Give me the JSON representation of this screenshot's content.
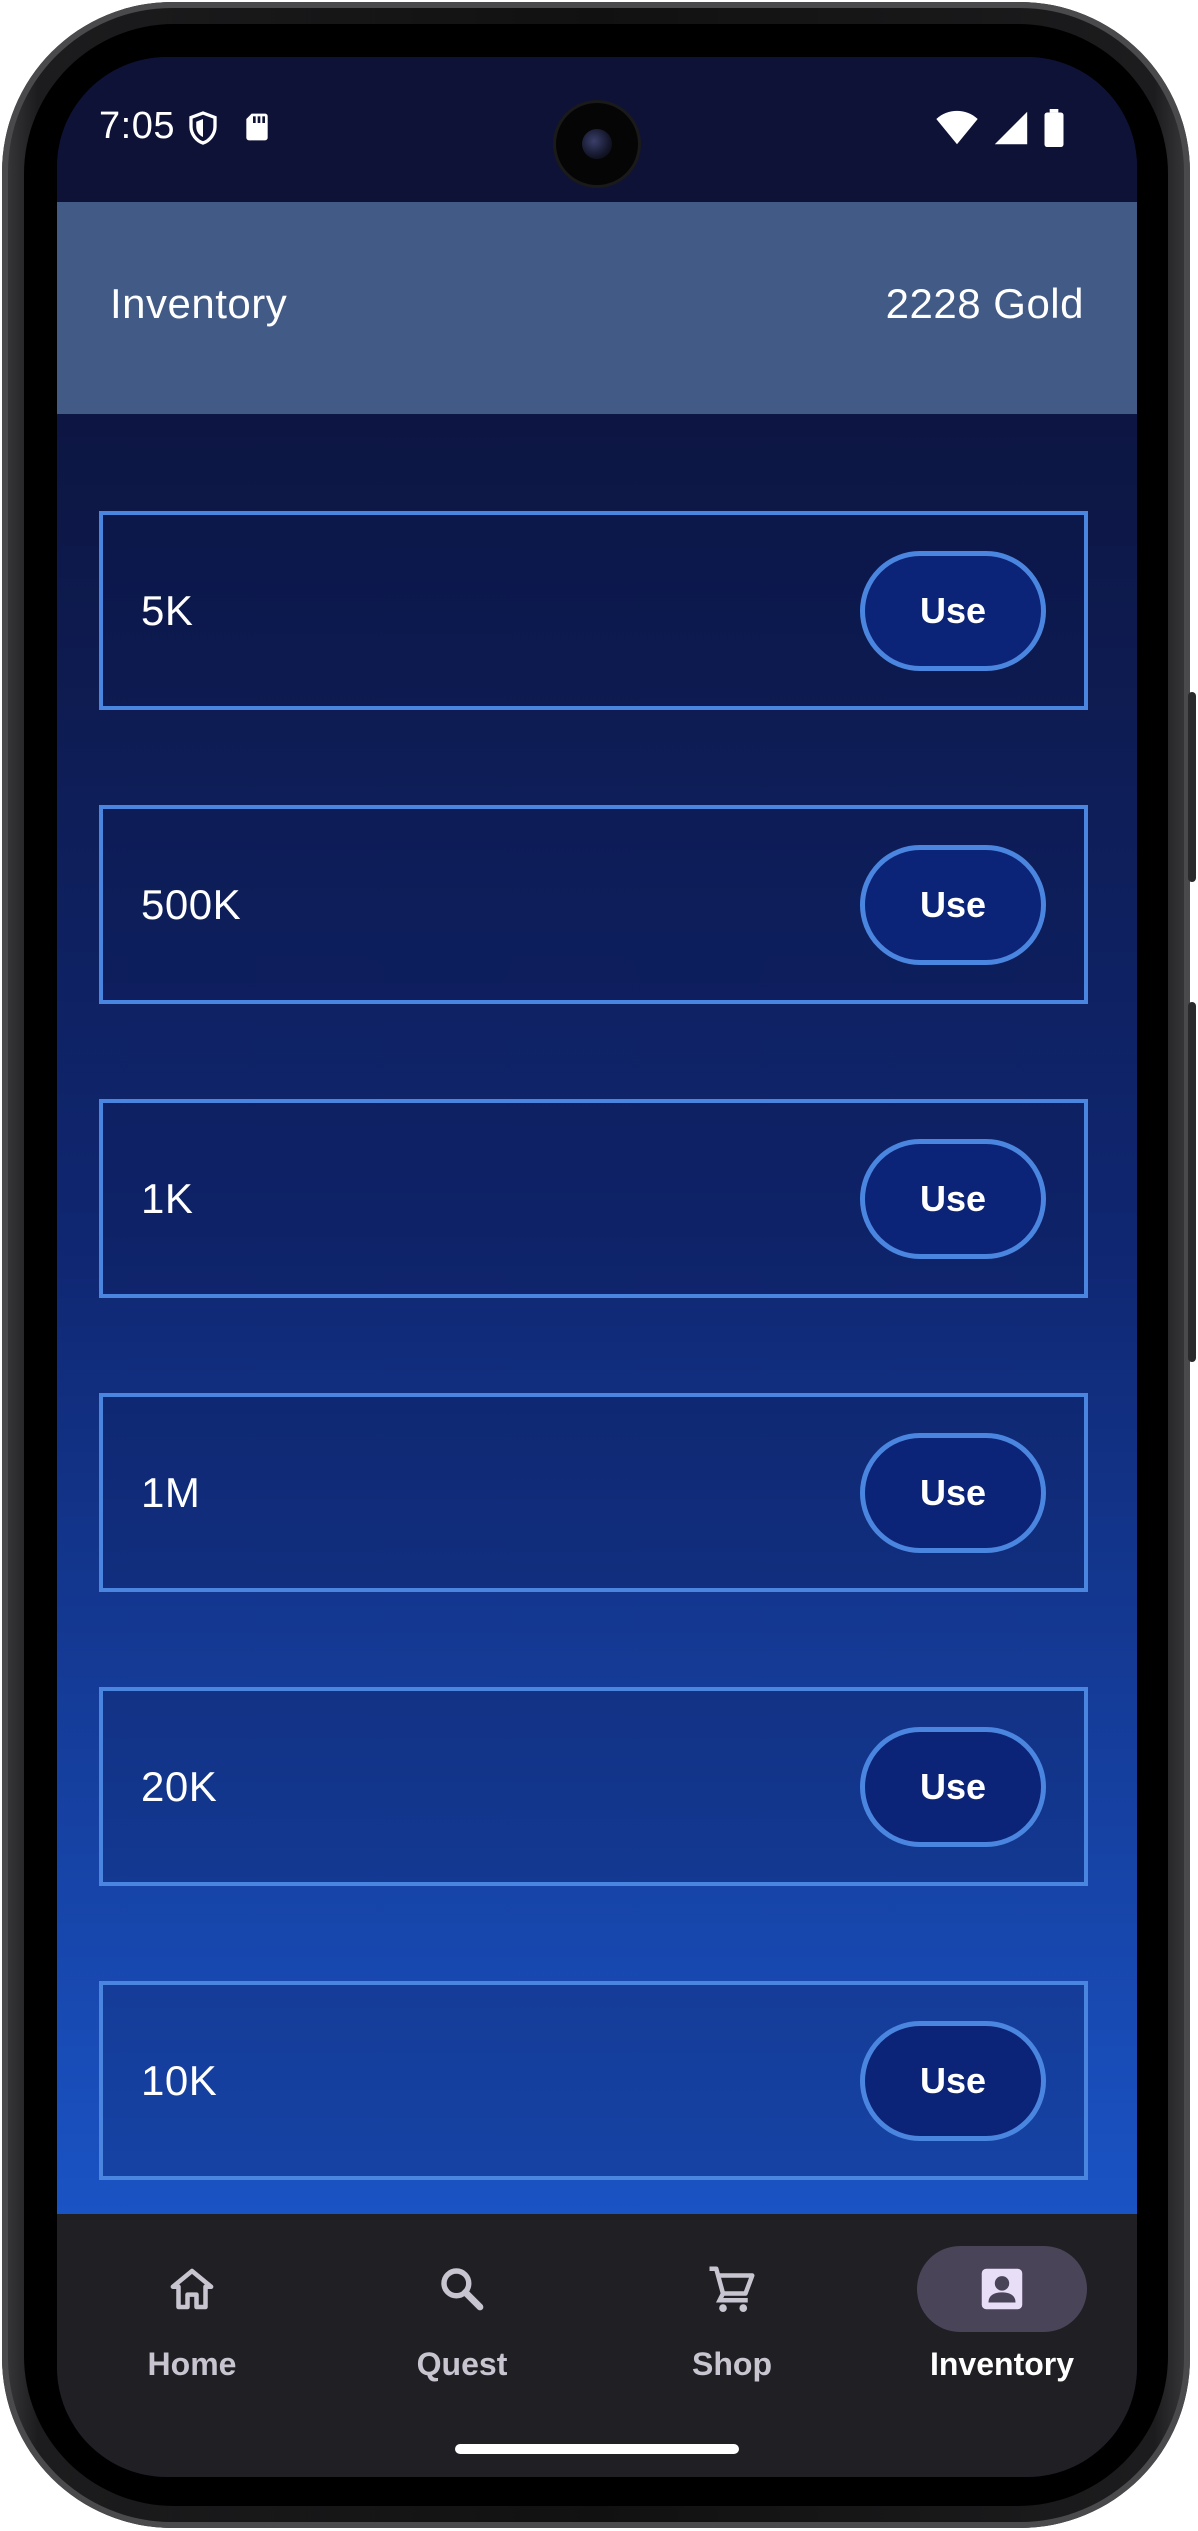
{
  "status_bar": {
    "time": "7:05",
    "left_icons": [
      "shield-icon",
      "sd-card-icon"
    ],
    "right_icons": [
      "wifi-icon",
      "cell-signal-icon",
      "battery-icon"
    ]
  },
  "app_bar": {
    "title": "Inventory",
    "gold": "2228 Gold"
  },
  "items": [
    {
      "label": "5K",
      "button": "Use"
    },
    {
      "label": "500K",
      "button": "Use"
    },
    {
      "label": "1K",
      "button": "Use"
    },
    {
      "label": "1M",
      "button": "Use"
    },
    {
      "label": "20K",
      "button": "Use"
    },
    {
      "label": "10K",
      "button": "Use"
    }
  ],
  "nav": {
    "items": [
      {
        "label": "Home",
        "icon": "home-icon",
        "active": false
      },
      {
        "label": "Quest",
        "icon": "search-icon",
        "active": false
      },
      {
        "label": "Shop",
        "icon": "cart-icon",
        "active": false
      },
      {
        "label": "Inventory",
        "icon": "account-box-icon",
        "active": true
      }
    ]
  },
  "colors": {
    "app_bar_bg": "#415a86",
    "card_border": "#4a86e0",
    "button_bg": "#0c2478",
    "nav_bg": "#1f1f24",
    "nav_active_pill": "#4a4458"
  }
}
